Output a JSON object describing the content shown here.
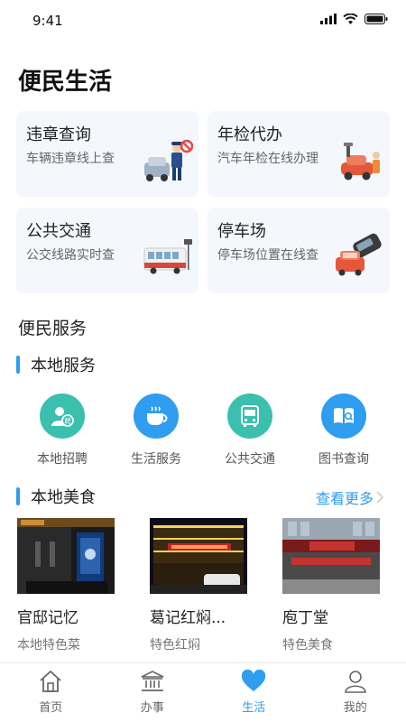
{
  "status_bar": {
    "time": "9:41"
  },
  "page_title": "便民生活",
  "cards": [
    {
      "title": "违章查询",
      "subtitle": "车辆违章线上查",
      "icon": "traffic-police-icon"
    },
    {
      "title": "年检代办",
      "subtitle": "汽车年检在线办理",
      "icon": "car-inspection-icon"
    },
    {
      "title": "公共交通",
      "subtitle": "公交线路实时查",
      "icon": "bus-icon"
    },
    {
      "title": "停车场",
      "subtitle": "停车场位置在线查",
      "icon": "parking-icon"
    }
  ],
  "services_section_title": "便民服务",
  "local_services": {
    "header": "本地服务",
    "items": [
      {
        "label": "本地招聘",
        "icon": "recruitment-icon",
        "color": "#3bbfae"
      },
      {
        "label": "生活服务",
        "icon": "coffee-cup-icon",
        "color": "#2f9df0"
      },
      {
        "label": "公共交通",
        "icon": "bus-icon",
        "color": "#3bbfae"
      },
      {
        "label": "图书查询",
        "icon": "book-search-icon",
        "color": "#2f9df0"
      }
    ]
  },
  "local_food": {
    "header": "本地美食",
    "more_label": "查看更多",
    "items": [
      {
        "name": "官邸记忆",
        "desc": "本地特色菜"
      },
      {
        "name": "葛记红焖...",
        "desc": "特色红焖"
      },
      {
        "name": "庖丁堂",
        "desc": "特色美食"
      }
    ]
  },
  "tabbar": [
    {
      "label": "首页",
      "icon": "home-icon",
      "active": false
    },
    {
      "label": "办事",
      "icon": "government-building-icon",
      "active": false
    },
    {
      "label": "生活",
      "icon": "heart-icon",
      "active": true
    },
    {
      "label": "我的",
      "icon": "user-icon",
      "active": false
    }
  ],
  "colors": {
    "accent": "#2f9df0",
    "teal": "#3bbfae",
    "card_bg": "#f4f7fb"
  }
}
